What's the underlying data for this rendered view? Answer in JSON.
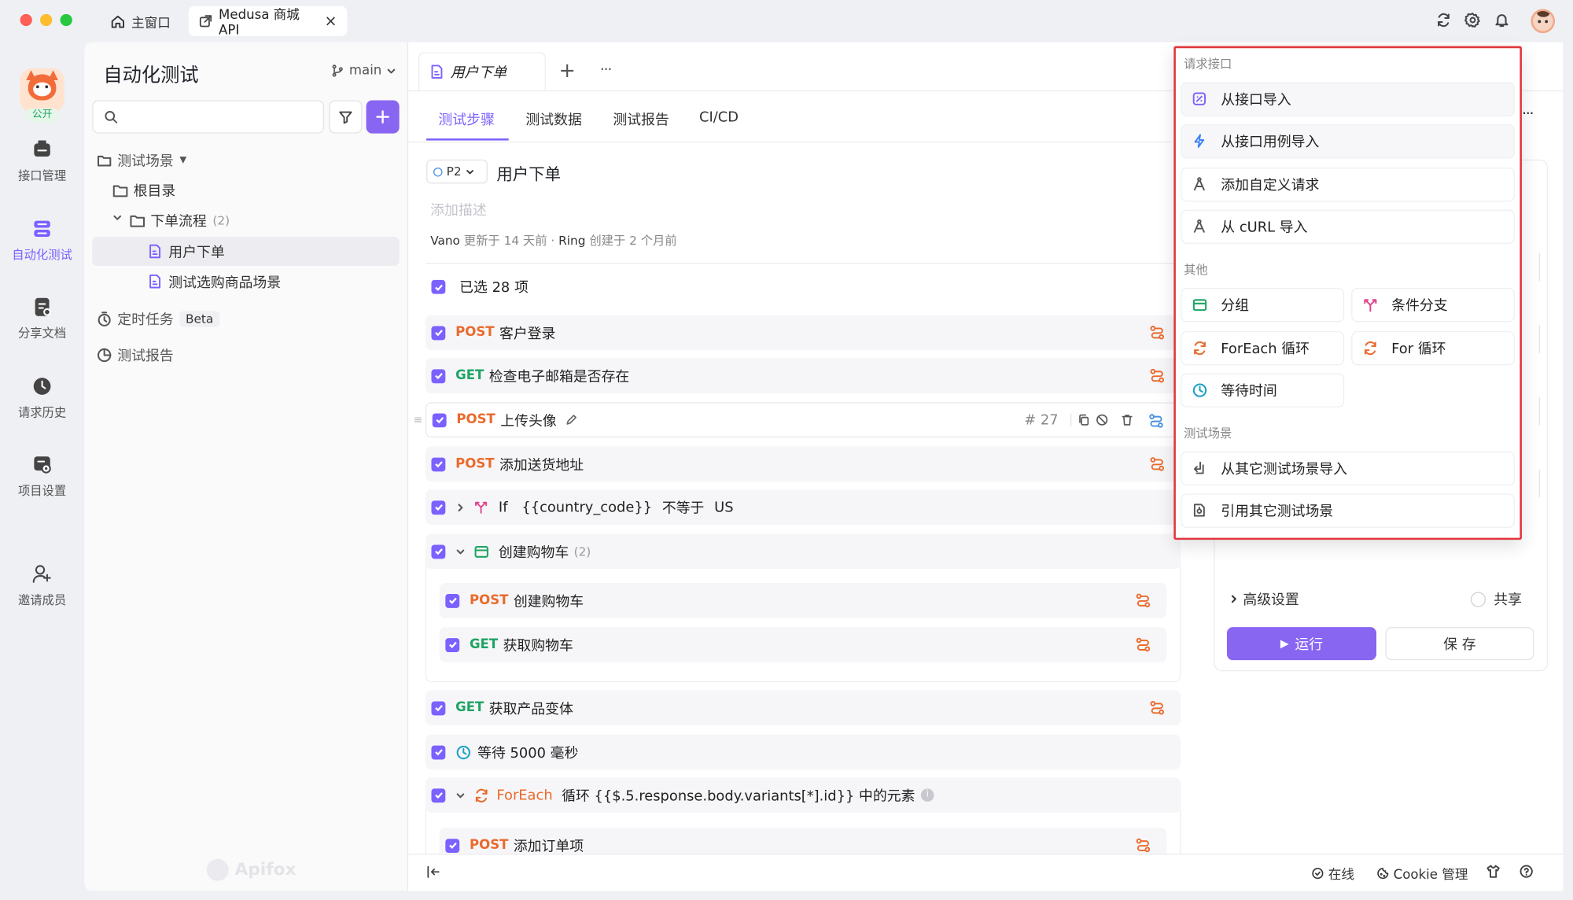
{
  "titlebar": {
    "home_tab": "主窗口",
    "project_tab": "Medusa 商城 API",
    "close": "×"
  },
  "rail": {
    "badge": "公开",
    "items": [
      {
        "label": "接口管理",
        "icon": "api-icon"
      },
      {
        "label": "自动化测试",
        "icon": "automation-icon"
      },
      {
        "label": "分享文档",
        "icon": "share-doc-icon"
      },
      {
        "label": "请求历史",
        "icon": "history-icon"
      },
      {
        "label": "项目设置",
        "icon": "settings-icon"
      },
      {
        "label": "邀请成员",
        "icon": "invite-icon"
      }
    ]
  },
  "panel": {
    "title": "自动化测试",
    "branch": "main",
    "search_placeholder": "",
    "tree": {
      "scenes": "测试场景",
      "root": "根目录",
      "folder": "下单流程",
      "folder_count": "(2)",
      "items": [
        "用户下单",
        "测试选购商品场景"
      ],
      "scheduled": "定时任务",
      "beta": "Beta",
      "reports": "测试报告"
    },
    "watermark": "Apifox"
  },
  "main": {
    "tabs": {
      "active_tab": "用户下单",
      "add": "+",
      "more": "···"
    },
    "subtabs": [
      "测试步骤",
      "测试数据",
      "测试报告",
      "CI/CD"
    ],
    "priority": "P2",
    "case_title": "用户下单",
    "desc_placeholder": "添加描述",
    "meta": {
      "updater": "Vano",
      "updated": "更新于 14 天前 ·",
      "creator": "Ring",
      "created": "创建于 2 个月前"
    },
    "selected": "已选 28 项",
    "steps": [
      {
        "method": "POST",
        "name": "客户登录"
      },
      {
        "method": "GET",
        "name": "检查电子邮箱是否存在"
      },
      {
        "method": "POST",
        "name": "上传头像",
        "num": "# 27"
      },
      {
        "method": "POST",
        "name": "添加送货地址"
      }
    ],
    "if_step": {
      "kw": "If",
      "var": "{{country_code}}",
      "op": "不等于",
      "val": "US"
    },
    "group": {
      "name": "创建购物车",
      "count": "(2)"
    },
    "group_steps": [
      {
        "method": "POST",
        "name": "创建购物车"
      },
      {
        "method": "GET",
        "name": "获取购物车"
      }
    ],
    "step_variant": {
      "method": "GET",
      "name": "获取产品变体"
    },
    "wait": "等待 5000 毫秒",
    "foreach": {
      "kw": "ForEach",
      "text": "循环 {{$.5.response.body.variants[*].id}} 中的元素"
    },
    "foreach_step": {
      "method": "POST",
      "name": "添加订单项"
    }
  },
  "dropdown": {
    "sec1": "请求接口",
    "import_api": "从接口导入",
    "import_case": "从接口用例导入",
    "custom_request": "添加自定义请求",
    "import_curl": "从 cURL 导入",
    "sec2": "其他",
    "group": "分组",
    "branch": "条件分支",
    "foreach": "ForEach 循环",
    "for": "For 循环",
    "wait": "等待时间",
    "sec3": "测试场景",
    "import_scene": "从其它测试场景导入",
    "ref_scene": "引用其它测试场景"
  },
  "right_form": {
    "advanced": "高级设置",
    "share": "共享",
    "run": "运行",
    "save": "保 存"
  },
  "footer": {
    "online": "在线",
    "cookie": "Cookie 管理"
  },
  "colors": {
    "accent": "#7b61ff",
    "post": "#ea6a2c",
    "get": "#1fa463",
    "highlight_border": "#e1363d"
  }
}
